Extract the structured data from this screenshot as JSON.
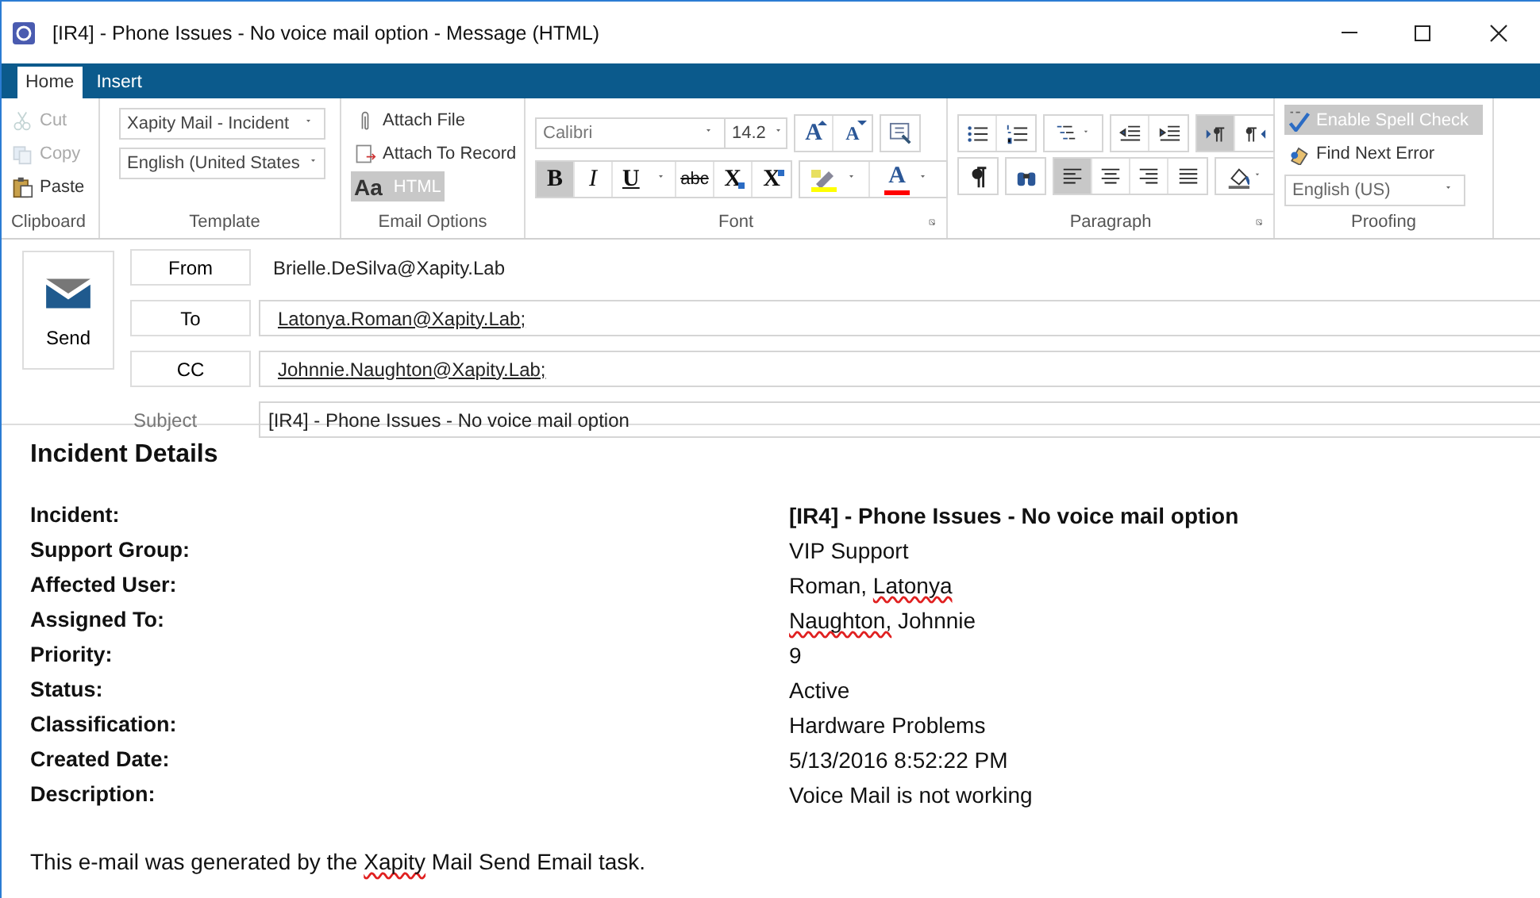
{
  "window": {
    "title": "[IR4] - Phone Issues - No voice mail option - Message (HTML)"
  },
  "ribbon": {
    "tabs": [
      {
        "label": "Home",
        "selected": true
      },
      {
        "label": "Insert",
        "selected": false
      }
    ],
    "clipboard": {
      "label": "Clipboard",
      "buttons": [
        {
          "label": "Cut",
          "kind": "cut",
          "disabled": true
        },
        {
          "label": "Copy",
          "kind": "copy",
          "disabled": true
        },
        {
          "label": "Paste",
          "kind": "paste",
          "disabled": false
        }
      ]
    },
    "template": {
      "label": "Template",
      "dropdowns": [
        "Xapity Mail - Incident",
        "English (United States"
      ]
    },
    "email_options": {
      "label": "Email Options",
      "buttons": [
        {
          "label": "Attach File",
          "kind": "attach",
          "selected": false
        },
        {
          "label": "Attach To Record",
          "kind": "record",
          "selected": false
        },
        {
          "label": "HTML",
          "glyph": "Aa",
          "kind": "format",
          "selected": true
        }
      ]
    },
    "font": {
      "label": "Font",
      "font_name": "Calibri",
      "font_size": "14.2",
      "size_buttons": [
        {
          "glyph": "A",
          "kind": "grow"
        },
        {
          "glyph": "A",
          "kind": "shrink"
        }
      ],
      "style_buttons": [
        {
          "glyph": "B",
          "kind": "bold",
          "selected": true
        },
        {
          "glyph": "I",
          "kind": "italic",
          "selected": false
        },
        {
          "glyph": "U",
          "kind": "underline",
          "selected": false
        },
        {
          "glyph": "abc",
          "kind": "strike",
          "selected": false
        },
        {
          "glyph": "X",
          "kind": "sub",
          "selected": false
        },
        {
          "glyph": "X",
          "kind": "sup",
          "selected": false
        }
      ],
      "color_buttons": [
        {
          "kind": "highlight",
          "color": "#ffff00"
        },
        {
          "kind": "font_color",
          "glyph": "A",
          "color": "#ff0000"
        }
      ]
    },
    "paragraph": {
      "label": "Paragraph",
      "rows": [
        [
          {
            "kind": "bullets",
            "selected": false
          },
          {
            "kind": "numbering",
            "selected": false
          },
          {
            "kind": "multilevel",
            "selected": false
          },
          {
            "kind": "outdent",
            "selected": false
          },
          {
            "kind": "indent",
            "selected": false
          },
          {
            "kind": "ltr",
            "selected": true
          },
          {
            "kind": "rtl",
            "selected": false
          }
        ],
        [
          {
            "kind": "pilcrow",
            "selected": false
          },
          {
            "kind": "find",
            "selected": false
          },
          {
            "kind": "align_left",
            "selected": true
          },
          {
            "kind": "align_center",
            "selected": false
          },
          {
            "kind": "align_right",
            "selected": false
          },
          {
            "kind": "justify",
            "selected": false
          },
          {
            "kind": "shading",
            "selected": false
          }
        ]
      ]
    },
    "proofing": {
      "label": "Proofing",
      "buttons": [
        {
          "label": "Enable Spell Check",
          "kind": "spell",
          "selected": true
        },
        {
          "label": "Find Next Error",
          "kind": "next_error",
          "selected": false
        }
      ],
      "language": "English (US)"
    }
  },
  "header": {
    "send": "Send",
    "fields": [
      {
        "kind": "button",
        "label": "From",
        "value": "Brielle.DeSilva@Xapity.Lab"
      },
      {
        "kind": "recipient",
        "label": "To",
        "value": "Latonya.Roman@Xapity.Lab;"
      },
      {
        "kind": "recipient",
        "label": "CC",
        "value": "Johnnie.Naughton@Xapity.Lab;"
      },
      {
        "kind": "subject",
        "label": "Subject",
        "value": "[IR4] - Phone Issues - No voice mail option"
      }
    ]
  },
  "body": {
    "heading": "Incident Details",
    "rows": [
      {
        "label": "Incident:",
        "bold": true,
        "value": [
          {
            "text": "[IR4] - Phone Issues - No voice mail option",
            "misspelled": false
          }
        ]
      },
      {
        "label": "Support Group:",
        "bold": false,
        "value": [
          {
            "text": "VIP Support",
            "misspelled": false
          }
        ]
      },
      {
        "label": "Affected User:",
        "bold": false,
        "value": [
          {
            "text": "Roman, ",
            "misspelled": false
          },
          {
            "text": "Latonya",
            "misspelled": true
          }
        ]
      },
      {
        "label": "Assigned To:",
        "bold": false,
        "value": [
          {
            "text": "Naughton,",
            "misspelled": true
          },
          {
            "text": " Johnnie",
            "misspelled": false
          }
        ]
      },
      {
        "label": "Priority:",
        "bold": false,
        "value": [
          {
            "text": "9",
            "misspelled": false
          }
        ]
      },
      {
        "label": "Status:",
        "bold": false,
        "value": [
          {
            "text": "Active",
            "misspelled": false
          }
        ]
      },
      {
        "label": "Classification:",
        "bold": false,
        "value": [
          {
            "text": "Hardware Problems",
            "misspelled": false
          }
        ]
      },
      {
        "label": "Created Date:",
        "bold": false,
        "value": [
          {
            "text": "5/13/2016 8:52:22 PM",
            "misspelled": false
          }
        ]
      },
      {
        "label": "Description:",
        "bold": false,
        "value": [
          {
            "text": "Voice Mail is not working",
            "misspelled": false
          }
        ]
      }
    ],
    "footer": [
      {
        "text": "This e-mail was generated by the ",
        "misspelled": false
      },
      {
        "text": "Xapity",
        "misspelled": true
      },
      {
        "text": " Mail Send Email task.",
        "misspelled": false
      }
    ]
  }
}
